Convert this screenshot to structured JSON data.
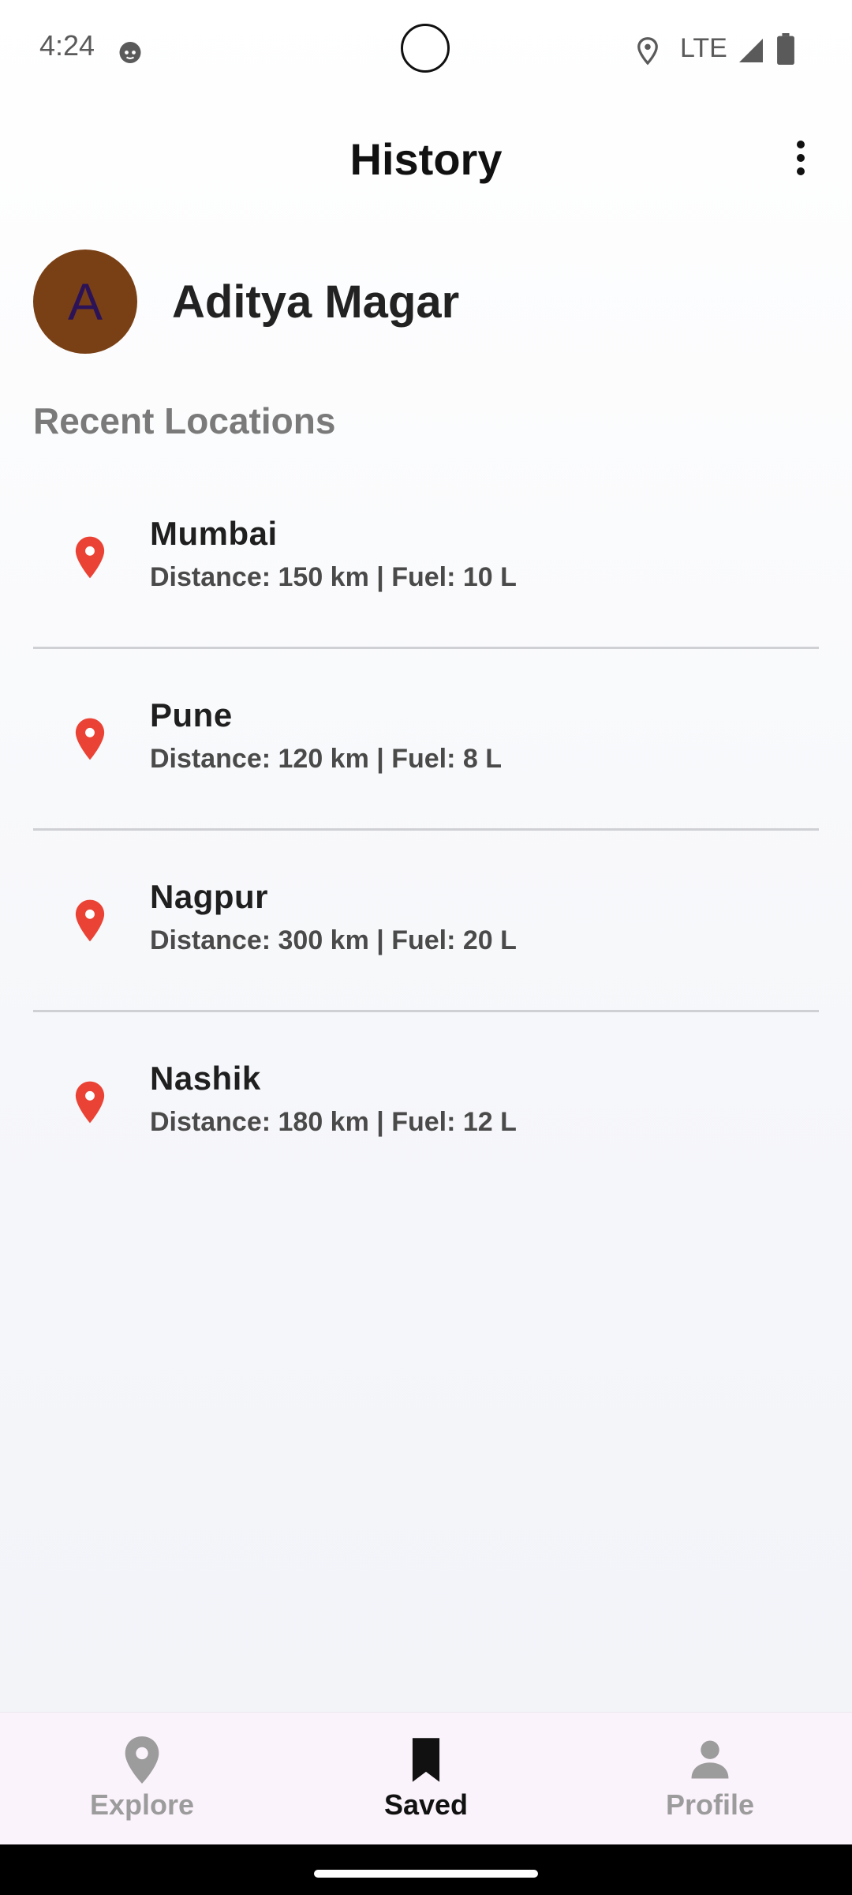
{
  "status_bar": {
    "time": "4:24",
    "network": "LTE",
    "icons": [
      "notification-face-icon",
      "location-icon",
      "signal-icon",
      "battery-icon"
    ]
  },
  "app_bar": {
    "title": "History",
    "menu_icon": "more-vert-icon"
  },
  "profile": {
    "avatar_initial": "A",
    "name": "Aditya Magar",
    "avatar_color": "#7a4015",
    "avatar_text_color": "#2c1358"
  },
  "section_title": "Recent Locations",
  "locations": [
    {
      "name": "Mumbai",
      "detail": "Distance: 150 km | Fuel: 10 L",
      "icon": "map-pin-icon"
    },
    {
      "name": "Pune",
      "detail": "Distance: 120 km | Fuel: 8 L",
      "icon": "map-pin-icon"
    },
    {
      "name": "Nagpur",
      "detail": "Distance: 300 km | Fuel: 20 L",
      "icon": "map-pin-icon"
    },
    {
      "name": "Nashik",
      "detail": "Distance: 180 km | Fuel: 12 L",
      "icon": "map-pin-icon"
    }
  ],
  "bottom_nav": {
    "items": [
      {
        "label": "Explore",
        "icon": "location-icon",
        "active": false
      },
      {
        "label": "Saved",
        "icon": "bookmark-icon",
        "active": true
      },
      {
        "label": "Profile",
        "icon": "person-icon",
        "active": false
      }
    ]
  },
  "colors": {
    "pin": "#ea4335",
    "nav_background": "#fbf3fb",
    "inactive_nav": "#9c9c9c",
    "active_nav": "#111111"
  }
}
